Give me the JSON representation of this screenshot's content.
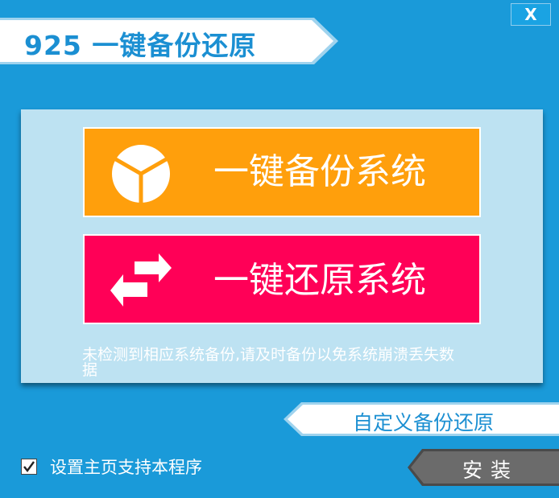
{
  "window": {
    "close_label": "X",
    "title": "925 一键备份还原"
  },
  "actions": {
    "backup_label": "一键备份系统",
    "restore_label": "一键还原系统"
  },
  "notice": "未检测到相应系统备份,请及时备份以免系统崩溃丢失数据",
  "custom_label": "自定义备份还原",
  "homepage_checkbox": {
    "label": "设置主页支持本程序",
    "checked": true
  },
  "install_label": "安装",
  "colors": {
    "background": "#1a9ad9",
    "panel": "#bde2f2",
    "backup_button": "#ff9f0c",
    "restore_button": "#ff0057",
    "title_text": "#1b8fd2",
    "install_button": "#666666"
  },
  "icons": {
    "backup": "pie-segment-icon",
    "restore": "swap-arrows-icon",
    "close": "close-icon",
    "checkbox": "checkmark-icon"
  }
}
